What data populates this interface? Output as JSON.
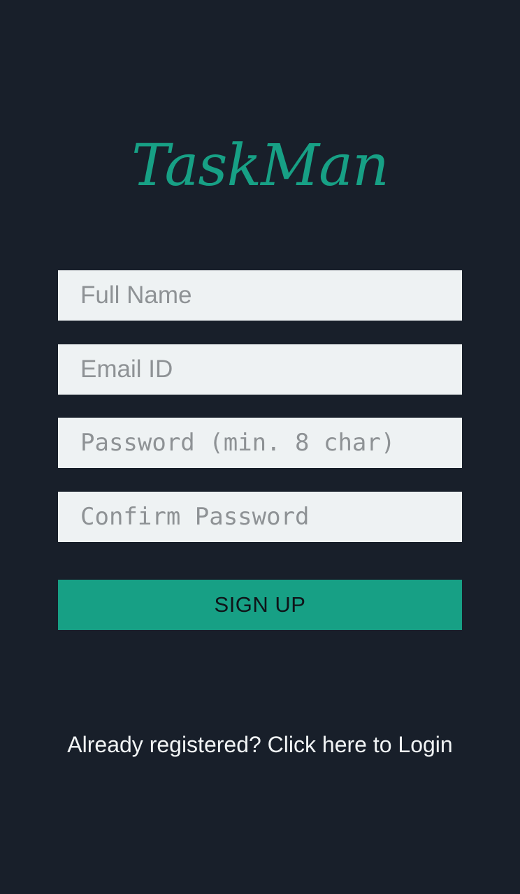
{
  "app": {
    "logo_text": "TaskMan"
  },
  "form": {
    "full_name": {
      "value": "",
      "placeholder": "Full Name"
    },
    "email": {
      "value": "",
      "placeholder": "Email ID"
    },
    "password": {
      "value": "",
      "placeholder": "Password (min. 8 char)"
    },
    "confirm_password": {
      "value": "",
      "placeholder": "Confirm Password"
    },
    "signup_label": "SIGN UP"
  },
  "footer": {
    "login_link": "Already registered? Click here to Login"
  },
  "colors": {
    "background": "#181f2a",
    "accent": "#17a085",
    "input_background": "#eef2f3",
    "placeholder": "#8e9295",
    "link_text": "#f1f4f5"
  }
}
